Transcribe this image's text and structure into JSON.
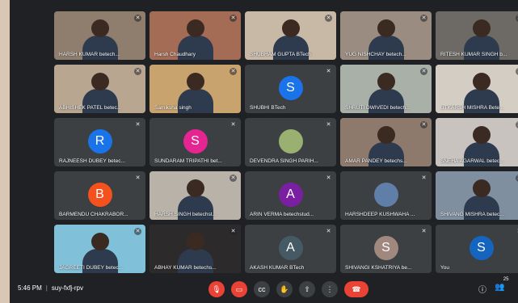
{
  "meeting": {
    "time": "5:46 PM",
    "code": "suy-fxfj-rpv"
  },
  "people_count": "25",
  "tiles": [
    {
      "name": "HARSH KUMAR betech...",
      "type": "video",
      "bg": "#8f7e6d"
    },
    {
      "name": "Harsh Chaudhary",
      "type": "video",
      "bg": "#a46b55"
    },
    {
      "name": "SHUBHAM GUPTA BTech",
      "type": "video",
      "bg": "#c8b8a6"
    },
    {
      "name": "YUG NISHCHAY betech...",
      "type": "video",
      "bg": "#9a8c80"
    },
    {
      "name": "RITESH KUMAR SINGH b...",
      "type": "video",
      "bg": "#6d6a66"
    },
    {
      "name": "ABHISHEK PATEL betec...",
      "type": "video",
      "bg": "#b8a690"
    },
    {
      "name": "Samiksha singh",
      "type": "video",
      "bg": "#c9a36e"
    },
    {
      "name": "SHUBHI BTech",
      "type": "avatar",
      "letter": "S",
      "color": "#1a73e8"
    },
    {
      "name": "SHRUTI DWIVEDI betech...",
      "type": "video",
      "bg": "#a9b0a8"
    },
    {
      "name": "UTKARSH MISHRA Bete...",
      "type": "video",
      "bg": "#d4cdc4"
    },
    {
      "name": "RAJNEESH DUBEY betec...",
      "type": "avatar",
      "letter": "R",
      "color": "#1a73e8"
    },
    {
      "name": "SUNDARAM TRIPATHI bet...",
      "type": "avatar",
      "letter": "S",
      "color": "#e52592"
    },
    {
      "name": "DEVENDRA SINGH PARIH...",
      "type": "avatar-img",
      "color": "#9ab070"
    },
    {
      "name": "AMAR PANDEY betechs...",
      "type": "video",
      "bg": "#8d7a6c"
    },
    {
      "name": "SNEHA AGARWAL betec...",
      "type": "video",
      "bg": "#c9c3bf"
    },
    {
      "name": "BARMENDU CHAKRABOR...",
      "type": "avatar",
      "letter": "B",
      "color": "#f4511e"
    },
    {
      "name": "HARSH SINGH betechst...",
      "type": "video",
      "bg": "#b9b2a9"
    },
    {
      "name": "ARIN VERMA betechstud...",
      "type": "avatar",
      "letter": "A",
      "color": "#7b1fa2"
    },
    {
      "name": "HARSHDEEP KUSHWAHA ...",
      "type": "avatar-img",
      "color": "#5f7ea8"
    },
    {
      "name": "SHIVANG MISHRA betec...",
      "type": "video",
      "bg": "#7f8fa0"
    },
    {
      "name": "JAGREETI DUBEY betec...",
      "type": "video",
      "bg": "#80c0d8"
    },
    {
      "name": "ABHAY KUMAR betechs...",
      "type": "video",
      "bg": "#2d2a2c"
    },
    {
      "name": "AKASH KUMAR BTech",
      "type": "avatar",
      "letter": "A",
      "color": "#455a64"
    },
    {
      "name": "SHIVANGI KSHATRIYA be...",
      "type": "avatar",
      "letter": "S",
      "color": "#a1887f"
    },
    {
      "name": "You",
      "type": "avatar",
      "letter": "S",
      "color": "#1565c0"
    }
  ],
  "icons": {
    "mic_off": "mic-off-icon",
    "cam_off": "camera-off-icon",
    "captions": "captions-icon",
    "raise_hand": "raise-hand-icon",
    "present": "present-icon",
    "more": "more-options-icon",
    "hangup": "hang-up-icon",
    "info": "info-icon",
    "people": "people-icon"
  }
}
